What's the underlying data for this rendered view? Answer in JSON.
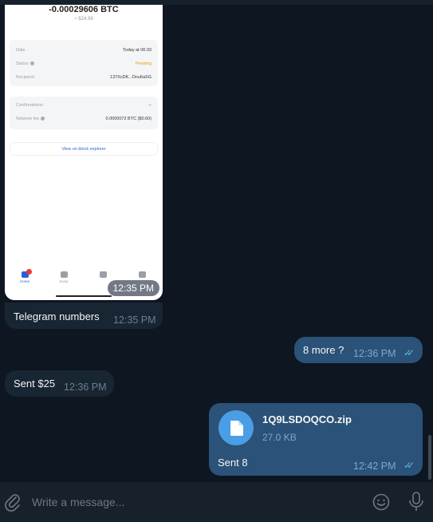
{
  "photo": {
    "amount": "-0.00029606 BTC",
    "usd": "≈ $24.98",
    "details": [
      {
        "label": "Date",
        "value": "Today at 06:33"
      },
      {
        "label": "Status",
        "value": "Pending"
      },
      {
        "label": "Recipient",
        "value": "137XcDK...Dnu6aSG"
      }
    ],
    "details2": [
      {
        "label": "Confirmations",
        "value": "--"
      },
      {
        "label": "Network fee",
        "value": "0.0000072 BTC ($0.60)"
      }
    ],
    "explorer_link": "View on block explorer",
    "nav": [
      "Home",
      "Swap",
      "",
      ""
    ],
    "time": "12:35 PM"
  },
  "messages": [
    {
      "text": "Telegram numbers",
      "time": "12:35 PM"
    },
    {
      "text": "8 more ?",
      "time": "12:36 PM"
    },
    {
      "text": "Sent $25",
      "time": "12:36 PM"
    },
    {
      "file_name": "1Q9LSDOQCO.zip",
      "file_size": "27.0 KB",
      "caption": "Sent 8",
      "time": "12:42 PM"
    }
  ],
  "composer": {
    "placeholder": "Write a message..."
  },
  "colors": {
    "background": "#0e1621",
    "incoming": "#182533",
    "outgoing": "#2b5278",
    "accent": "#5db5f0"
  }
}
